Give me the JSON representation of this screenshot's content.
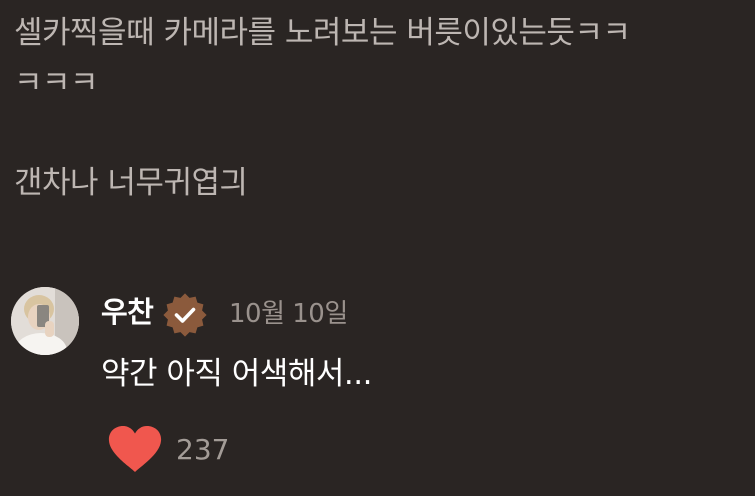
{
  "comment": {
    "line1": "셀카찍을때 카메라를 노려보는 버릇이있는듯ㅋㅋ",
    "line2": "ㅋㅋㅋ",
    "line3": "갠차나 너무귀엽긔"
  },
  "reply": {
    "username": "우찬",
    "date": "10월 10일",
    "text": "약간 아직 어색해서...",
    "like_count": "237",
    "badge_color": "#8b5a3c",
    "heart_color": "#f0574e"
  }
}
